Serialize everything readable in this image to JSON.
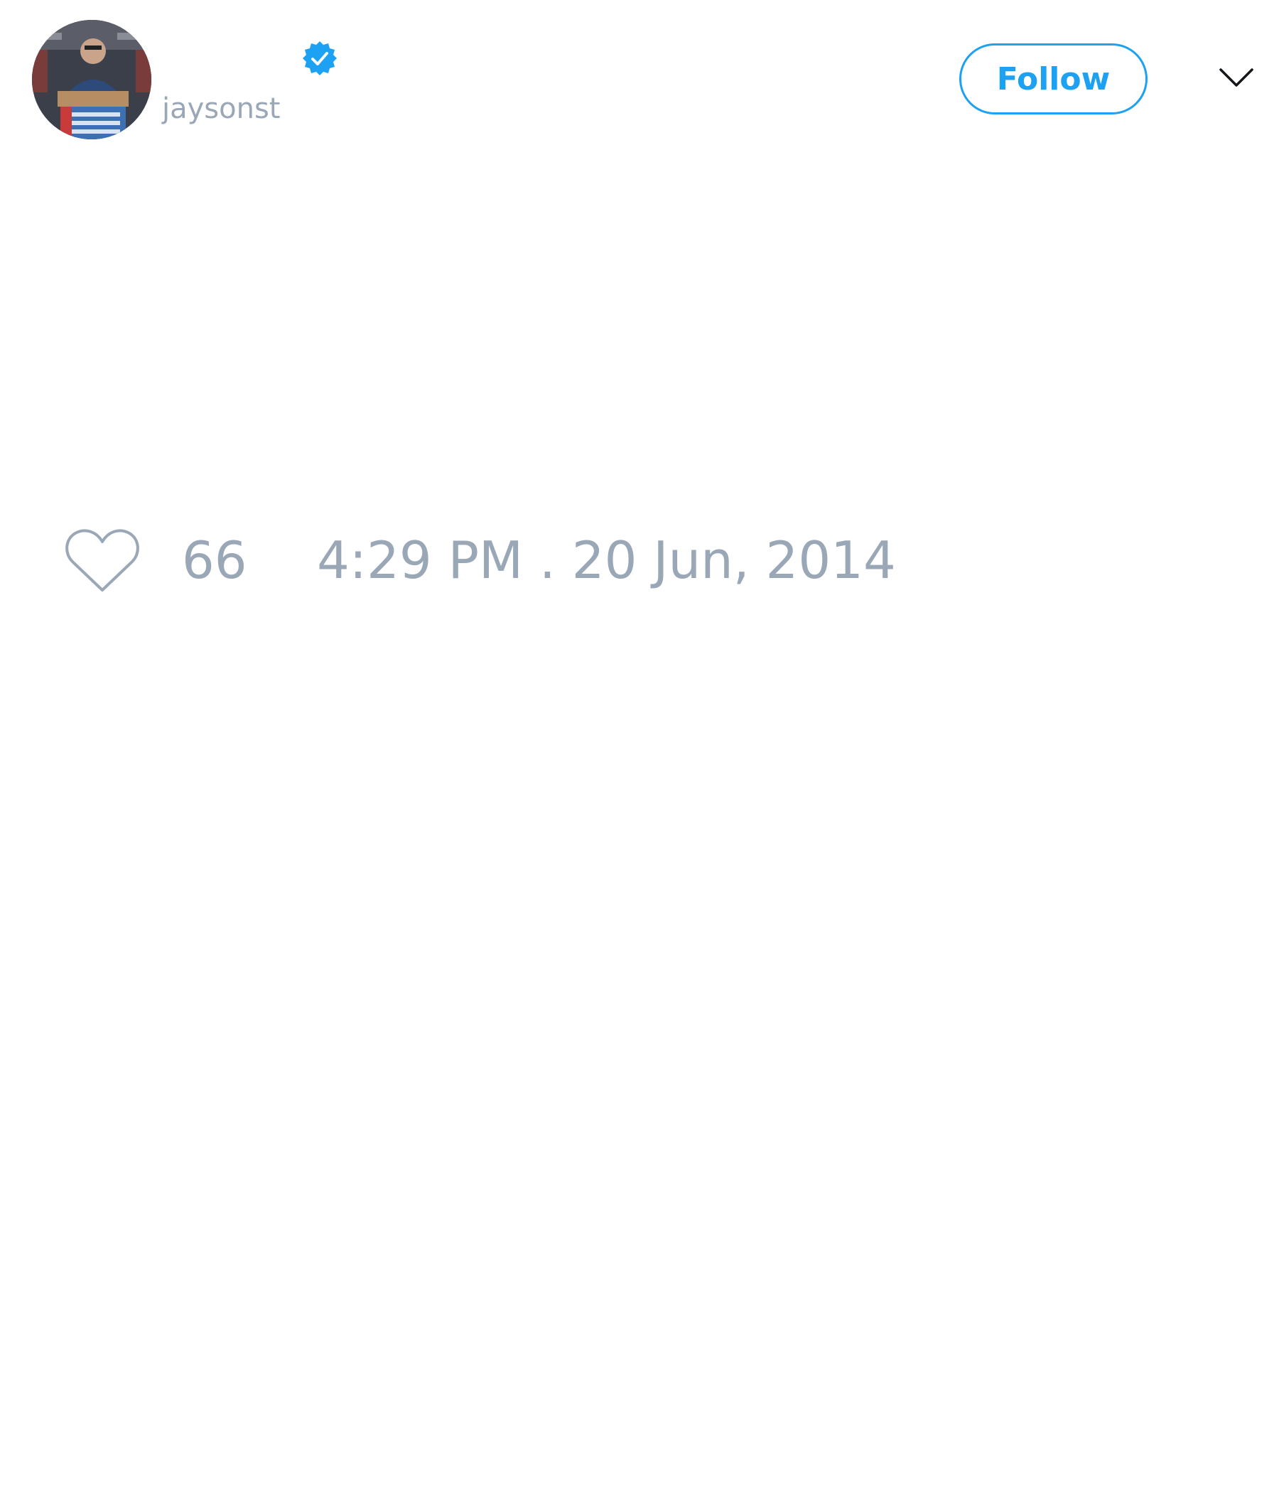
{
  "colors": {
    "accent": "#1da1f2",
    "muted_text": "#9aa7b6",
    "background": "#ffffff"
  },
  "header": {
    "display_name": "",
    "handle": "jaysonst",
    "verified": true,
    "verified_icon": "verified-badge-icon",
    "follow_label": "Follow",
    "menu_icon": "chevron-down-icon"
  },
  "tweet": {
    "text": ""
  },
  "footer": {
    "like_icon": "heart-icon",
    "like_count": "66",
    "timestamp": "4:29 PM . 20 Jun, 2014"
  }
}
